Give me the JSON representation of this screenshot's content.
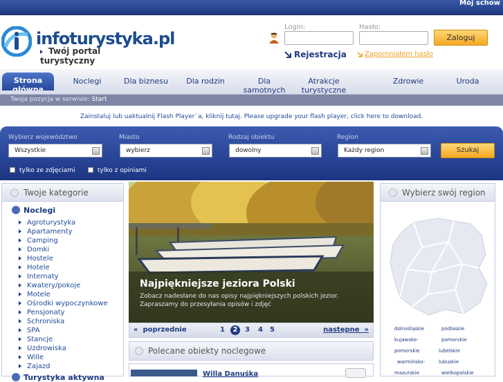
{
  "topbar": {
    "right_text": "Mój schow"
  },
  "logo": {
    "brand": "infoturystyka.pl",
    "tagline": "Twój portal turystyczny"
  },
  "login": {
    "login_label": "Login:",
    "password_label": "Hasło:",
    "submit": "Zaloguj",
    "register": "Rejestracja",
    "forgot": "Zapomniałem hasło"
  },
  "nav": {
    "items": [
      "Strona główna",
      "Noclegi",
      "Dla biznesu",
      "Dla rodzin",
      "Dla samotnych",
      "Atrakcje turystyczne",
      "Zdrowie",
      "Uroda"
    ]
  },
  "breadcrumb": {
    "prefix": "Twoja pozycja w serwisie:",
    "link": "Start"
  },
  "flash_notice": "Zainstaluj lub uaktualnij Flash Player`a, kliknij tutaj. Please upgrade your flash player, click here to download.",
  "search": {
    "labels": [
      "Wybierz województwo",
      "Miasto",
      "Rodzaj obiektu",
      "Region"
    ],
    "values": [
      "Wszystkie",
      "wybierz",
      "dowolny",
      "Każdy region"
    ],
    "button": "Szukaj",
    "chk_photos": "tylko ze zdjęciami",
    "chk_opinions": "tylko z opiniami"
  },
  "categories": {
    "title": "Twoje kategorie",
    "group": "Noclegi",
    "items": [
      "Agroturystyka",
      "Apartamenty",
      "Camping",
      "Domki",
      "Hostele",
      "Hotele",
      "Internaty",
      "Kwatery/pokoje",
      "Motele",
      "Ośrodki wypoczynkowe",
      "Pensjonaty",
      "Schroniska",
      "SPA",
      "Stancje",
      "Uzdrowiska",
      "Wille",
      "Zajazd"
    ],
    "next_group": "Turystyka aktywna"
  },
  "hero": {
    "caption": "Najpiękniejsze jeziora Polski",
    "desc": "Zobacz nadesłane do nas opisy najpiękniejszych polskich jezior. Zapraszamy do przesyłania opisów i zdjęć"
  },
  "pager": {
    "prev": "poprzednie",
    "next": "następne",
    "pages": [
      "1",
      "2",
      "3",
      "4",
      "5"
    ],
    "current": "2"
  },
  "recommended": {
    "title": "Polecane obiekty noclegowe",
    "first_item": "Willa Danuśka"
  },
  "regions": {
    "title": "Wybierz swój region",
    "labels": [
      "dolnośląskie",
      "podlaskie",
      "kujawsko-",
      "pomorskie",
      "pomorskie",
      "lubelskie",
      "warmińsko-",
      "lubuskie",
      "mazurskie",
      "wielkopolskie"
    ]
  },
  "colors": {
    "brand_blue": "#1e3a80",
    "accent_orange": "#f5a823"
  }
}
